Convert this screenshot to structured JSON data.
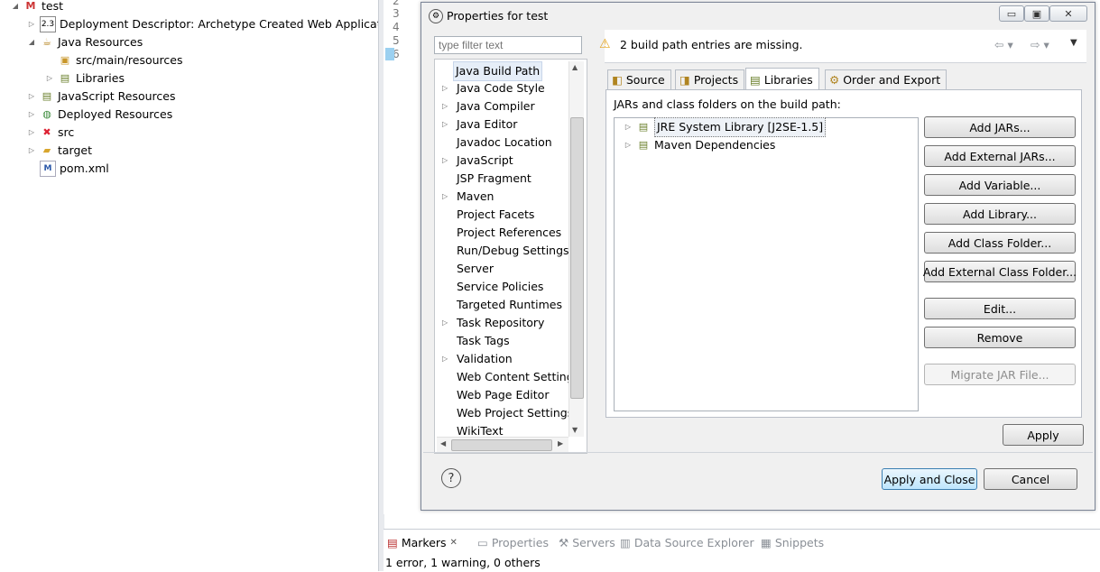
{
  "explorer": {
    "items": [
      {
        "label": "test",
        "expanded": true,
        "icon": "project-icon"
      },
      {
        "label": "Deployment Descriptor: Archetype Created Web Application",
        "expanded": false,
        "icon": "deployment-descriptor-icon"
      },
      {
        "label": "Java Resources",
        "expanded": true,
        "icon": "java-resources-icon"
      },
      {
        "label": "src/main/resources",
        "icon": "source-folder-icon"
      },
      {
        "label": "Libraries",
        "expanded": false,
        "icon": "libraries-icon"
      },
      {
        "label": "JavaScript Resources",
        "expanded": false,
        "icon": "javascript-resources-icon"
      },
      {
        "label": "Deployed Resources",
        "expanded": false,
        "icon": "deployed-resources-icon"
      },
      {
        "label": "src",
        "expanded": false,
        "icon": "folder-error-icon"
      },
      {
        "label": "target",
        "expanded": false,
        "icon": "folder-icon"
      },
      {
        "label": "pom.xml",
        "icon": "maven-pom-icon"
      }
    ]
  },
  "editor": {
    "line_numbers": [
      "2",
      "3",
      "4",
      "5",
      "6"
    ]
  },
  "dialog": {
    "title": "Properties for test",
    "filter_placeholder": "type filter text",
    "message": "2 build path entries are missing.",
    "nav_items": [
      {
        "label": "Java Build Path",
        "expandable": false,
        "selected": true
      },
      {
        "label": "Java Code Style",
        "expandable": true
      },
      {
        "label": "Java Compiler",
        "expandable": true
      },
      {
        "label": "Java Editor",
        "expandable": true
      },
      {
        "label": "Javadoc Location",
        "expandable": false
      },
      {
        "label": "JavaScript",
        "expandable": true
      },
      {
        "label": "JSP Fragment",
        "expandable": false
      },
      {
        "label": "Maven",
        "expandable": true
      },
      {
        "label": "Project Facets",
        "expandable": false
      },
      {
        "label": "Project References",
        "expandable": false
      },
      {
        "label": "Run/Debug Settings",
        "expandable": false
      },
      {
        "label": "Server",
        "expandable": false
      },
      {
        "label": "Service Policies",
        "expandable": false
      },
      {
        "label": "Targeted Runtimes",
        "expandable": false
      },
      {
        "label": "Task Repository",
        "expandable": true
      },
      {
        "label": "Task Tags",
        "expandable": false
      },
      {
        "label": "Validation",
        "expandable": true
      },
      {
        "label": "Web Content Settings",
        "expandable": false
      },
      {
        "label": "Web Page Editor",
        "expandable": false
      },
      {
        "label": "Web Project Settings",
        "expandable": false
      },
      {
        "label": "WikiText",
        "expandable": false
      }
    ],
    "tabs": [
      {
        "label": "Source",
        "icon": "source-tab-icon",
        "active": false
      },
      {
        "label": "Projects",
        "icon": "projects-tab-icon",
        "active": false
      },
      {
        "label": "Libraries",
        "icon": "libraries-tab-icon",
        "active": true
      },
      {
        "label": "Order and Export",
        "icon": "order-export-tab-icon",
        "active": false
      }
    ],
    "jars_label": "JARs and class folders on the build path:",
    "jar_entries": [
      {
        "label": "JRE System Library [J2SE-1.5]"
      },
      {
        "label": "Maven Dependencies"
      }
    ],
    "buttons": {
      "add_jars": "Add JARs...",
      "add_external_jars": "Add External JARs...",
      "add_variable": "Add Variable...",
      "add_library": "Add Library...",
      "add_class_folder": "Add Class Folder...",
      "add_external_class_folder": "Add External Class Folder...",
      "edit": "Edit...",
      "remove": "Remove",
      "migrate_jar": "Migrate JAR File...",
      "apply": "Apply",
      "apply_and_close": "Apply and Close",
      "cancel": "Cancel"
    }
  },
  "markers_panel": {
    "tabs": [
      "Markers",
      "Properties",
      "Servers",
      "Data Source Explorer",
      "Snippets"
    ],
    "status": "1 error, 1 warning, 0 others"
  }
}
